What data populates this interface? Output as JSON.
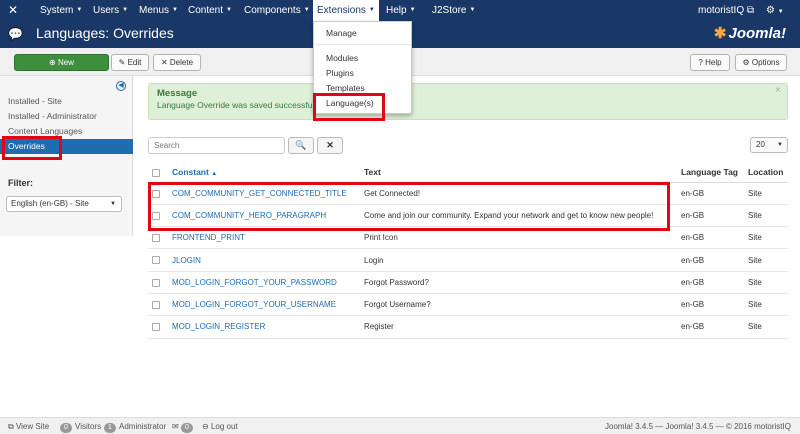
{
  "nav": {
    "items": [
      {
        "label": "System"
      },
      {
        "label": "Users"
      },
      {
        "label": "Menus"
      },
      {
        "label": "Content"
      },
      {
        "label": "Components"
      },
      {
        "label": "Extensions"
      },
      {
        "label": "Help"
      },
      {
        "label": "J2Store"
      }
    ],
    "user": "motoristIQ",
    "external_icon": "external-link-icon",
    "gear_icon": "gear-icon"
  },
  "header": {
    "title": "Languages: Overrides",
    "logo_text": "Joomla!"
  },
  "extensions_menu": {
    "items": [
      "Manage",
      "Modules",
      "Plugins",
      "Templates",
      "Language(s)"
    ]
  },
  "toolbar": {
    "new_label": "New",
    "edit_label": "Edit",
    "delete_label": "Delete",
    "help_label": "Help",
    "options_label": "Options"
  },
  "sidebar": {
    "items": [
      {
        "label": "Installed - Site"
      },
      {
        "label": "Installed - Administrator"
      },
      {
        "label": "Content Languages"
      },
      {
        "label": "Overrides"
      }
    ],
    "filter_label": "Filter:",
    "filter_value": "English (en-GB) - Site"
  },
  "message": {
    "heading": "Message",
    "text": "Language Override was saved successfully."
  },
  "search": {
    "placeholder": "Search",
    "limit": "20"
  },
  "table": {
    "headers": {
      "constant": "Constant",
      "text": "Text",
      "language_tag": "Language Tag",
      "location": "Location"
    },
    "rows": [
      {
        "constant": "COM_COMMUNITY_GET_CONNECTED_TITLE",
        "text": "Get Connected!",
        "tag": "en-GB",
        "location": "Site"
      },
      {
        "constant": "COM_COMMUNITY_HERO_PARAGRAPH",
        "text": "Come and join our community. Expand your network and get to know new people!",
        "tag": "en-GB",
        "location": "Site"
      },
      {
        "constant": "FRONTEND_PRINT",
        "text": "Print Icon",
        "tag": "en-GB",
        "location": "Site"
      },
      {
        "constant": "JLOGIN",
        "text": "Login",
        "tag": "en-GB",
        "location": "Site"
      },
      {
        "constant": "MOD_LOGIN_FORGOT_YOUR_PASSWORD",
        "text": "Forgot Password?",
        "tag": "en-GB",
        "location": "Site"
      },
      {
        "constant": "MOD_LOGIN_FORGOT_YOUR_USERNAME",
        "text": "Forgot Username?",
        "tag": "en-GB",
        "location": "Site"
      },
      {
        "constant": "MOD_LOGIN_REGISTER",
        "text": "Register",
        "tag": "en-GB",
        "location": "Site"
      }
    ]
  },
  "footer": {
    "view_site": "View Site",
    "visitors_count": "0",
    "visitors_label": "Visitors",
    "admin_count": "1",
    "admin_label": "Administrator",
    "messages_count": "0",
    "logout_label": "Log out",
    "copyright": "Joomla! 3.4.5 — Joomla! 3.4.5 — © 2016 motoristIQ"
  },
  "colors": {
    "navbar": "#1a3867",
    "accent": "#1f6cb0",
    "highlight_box": "#e20613",
    "success_bg": "#dff0d8"
  }
}
